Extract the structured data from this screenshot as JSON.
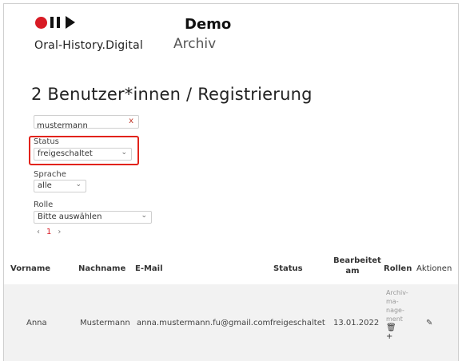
{
  "header": {
    "brand_name": "Oral-History.Digital",
    "title": "Demo",
    "subtitle": "Archiv"
  },
  "page": {
    "title": "2 Benutzer*innen / Registrierung"
  },
  "filters": {
    "search_value": "mustermann",
    "clear_glyph": "x",
    "status": {
      "label": "Status",
      "value": "freigeschaltet"
    },
    "language": {
      "label": "Sprache",
      "value": "alle"
    },
    "role": {
      "label": "Rolle",
      "value": "Bitte auswählen"
    }
  },
  "pagination": {
    "prev": "‹",
    "current": "1",
    "next": "›"
  },
  "table": {
    "columns": {
      "vorname": "Vorname",
      "nachname": "Nachname",
      "email": "E-Mail",
      "status": "Status",
      "edited_1": "Bearbeitet",
      "edited_2": "am",
      "rollen": "Rollen",
      "aktionen": "Aktionen"
    },
    "rows": [
      {
        "vorname": "Anna",
        "nachname": "Mustermann",
        "email": "anna.mustermann.fu@gmail.com",
        "status": "freigeschaltet",
        "edited": "13.01.2022",
        "roles_lines": [
          "Archiv-",
          "ma-",
          "nage-",
          "ment"
        ],
        "edit_glyph": "✎"
      }
    ]
  },
  "colors": {
    "accent": "#d81b25",
    "highlight": "#e2231a"
  }
}
